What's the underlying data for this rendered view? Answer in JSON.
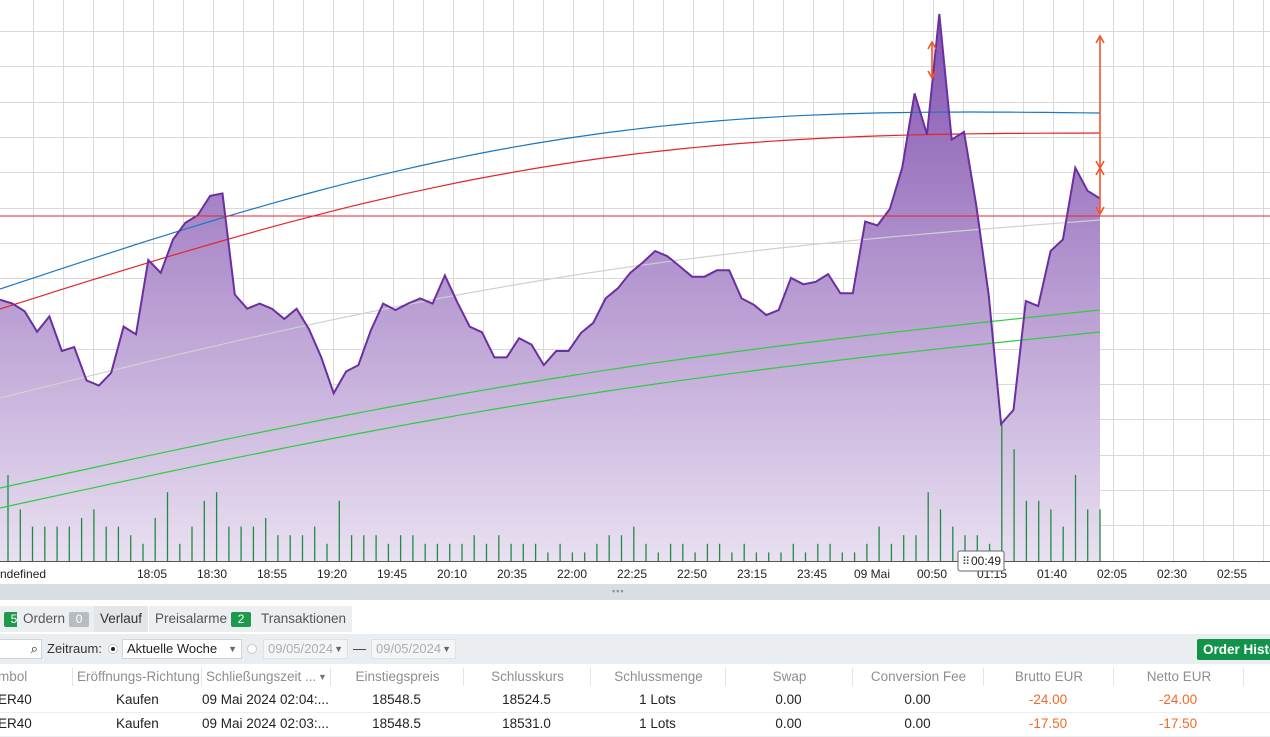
{
  "chart": {
    "background": "#ffffff",
    "grid_color": "#d9d9d9",
    "price_fill_top": "#8353b0",
    "price_fill_bottom": "#e9e0f1",
    "price_line_color": "#6a2fa0",
    "volume_color": "#1f8a45",
    "ma_colors": [
      "#1a78c2",
      "#e5232b",
      "#d0d0d0",
      "#2ecc40",
      "#2ecc40"
    ],
    "h_line_color": "#e5232b",
    "arrow_color": "#f0552a",
    "undefined_label": "ndefined",
    "x_ticks": [
      "18:05",
      "18:30",
      "18:55",
      "19:20",
      "19:45",
      "20:10",
      "20:35",
      "22:00",
      "22:25",
      "22:50",
      "23:15",
      "23:45",
      "09 Mai",
      "00:50",
      "01:15",
      "01:40",
      "02:05",
      "02:30",
      "02:55"
    ],
    "crosshair_time": "00:49",
    "price_series": [
      0.485,
      0.47,
      0.44,
      0.36,
      0.42,
      0.285,
      0.3,
      0.17,
      0.15,
      0.2,
      0.38,
      0.35,
      0.64,
      0.59,
      0.72,
      0.785,
      0.815,
      0.89,
      0.9,
      0.505,
      0.45,
      0.47,
      0.45,
      0.41,
      0.45,
      0.37,
      0.26,
      0.12,
      0.205,
      0.23,
      0.365,
      0.47,
      0.445,
      0.47,
      0.49,
      0.47,
      0.58,
      0.475,
      0.38,
      0.358,
      0.26,
      0.26,
      0.335,
      0.31,
      0.23,
      0.285,
      0.285,
      0.355,
      0.395,
      0.49,
      0.53,
      0.59,
      0.63,
      0.675,
      0.655,
      0.615,
      0.575,
      0.575,
      0.6,
      0.6,
      0.49,
      0.465,
      0.425,
      0.445,
      0.57,
      0.545,
      0.555,
      0.585,
      0.51,
      0.51,
      0.79,
      0.775,
      0.84,
      1.0,
      1.29,
      1.13,
      1.6,
      1.11,
      1.14,
      0.85,
      0.5,
      0.0,
      0.055,
      0.48,
      0.46,
      0.675,
      0.72,
      1.0,
      0.91,
      0.88
    ],
    "volume_series": [
      0.1,
      0.06,
      0.04,
      0.04,
      0.04,
      0.04,
      0.05,
      0.06,
      0.04,
      0.04,
      0.03,
      0.02,
      0.05,
      0.08,
      0.02,
      0.04,
      0.07,
      0.08,
      0.04,
      0.04,
      0.04,
      0.05,
      0.03,
      0.03,
      0.03,
      0.04,
      0.02,
      0.07,
      0.03,
      0.03,
      0.03,
      0.02,
      0.03,
      0.03,
      0.02,
      0.02,
      0.02,
      0.02,
      0.03,
      0.02,
      0.03,
      0.02,
      0.02,
      0.02,
      0.01,
      0.02,
      0.01,
      0.01,
      0.02,
      0.03,
      0.03,
      0.04,
      0.02,
      0.01,
      0.02,
      0.02,
      0.01,
      0.02,
      0.02,
      0.01,
      0.02,
      0.01,
      0.01,
      0.01,
      0.02,
      0.01,
      0.02,
      0.02,
      0.01,
      0.01,
      0.02,
      0.04,
      0.02,
      0.03,
      0.03,
      0.08,
      0.06,
      0.04,
      0.03,
      0.03,
      0.02,
      0.16,
      0.13,
      0.07,
      0.07,
      0.06,
      0.04,
      0.1,
      0.06,
      0.06
    ]
  },
  "tabs": [
    {
      "label": "",
      "badge": "5",
      "badge_style": "green",
      "active": false
    },
    {
      "label": "Ordern",
      "badge": "0",
      "badge_style": "grey",
      "active": false
    },
    {
      "label": "Verlauf",
      "badge": "",
      "badge_style": "",
      "active": true
    },
    {
      "label": "Preisalarme",
      "badge": "2",
      "badge_style": "green",
      "active": false
    },
    {
      "label": "Transaktionen",
      "badge": "",
      "badge_style": "",
      "active": false
    }
  ],
  "filter": {
    "zeitraum_label": "Zeitraum:",
    "period_value": "Aktuelle Woche",
    "date_from": "09/05/2024",
    "date_to": "09/05/2024",
    "dash": "—",
    "order_button": "Order Histo"
  },
  "table": {
    "columns": [
      "mbol",
      "Eröffnungs-Richtung",
      "Schließungszeit ...",
      "Einstiegspreis",
      "Schlusskurs",
      "Schlussmenge",
      "Swap",
      "Conversion Fee",
      "Brutto EUR",
      "Netto EUR"
    ],
    "rows": [
      [
        "ER40",
        "Kaufen",
        "09 Mai 2024 02:04:...",
        "18548.5",
        "18524.5",
        "1 Lots",
        "0.00",
        "0.00",
        "-24.00",
        "-24.00"
      ],
      [
        "ER40",
        "Kaufen",
        "09 Mai 2024 02:03:...",
        "18548.5",
        "18531.0",
        "1 Lots",
        "0.00",
        "0.00",
        "-17.50",
        "-17.50"
      ]
    ]
  }
}
